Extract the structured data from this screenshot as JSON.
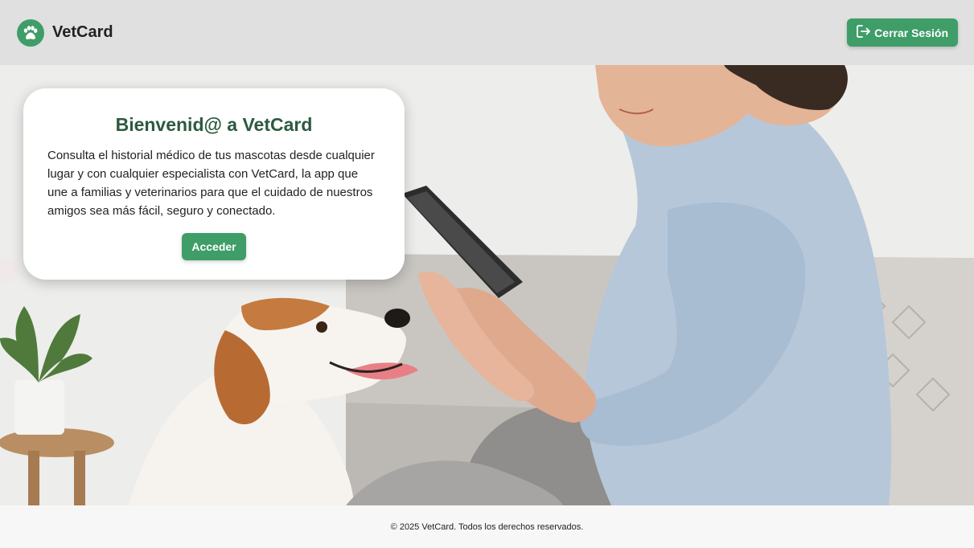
{
  "header": {
    "brand_name": "VetCard",
    "logo_icon": "paw-icon",
    "logout_icon": "logout-icon",
    "logout_label": "Cerrar Sesión"
  },
  "hero": {
    "image": "woman-with-tablet-and-dog-photo",
    "card": {
      "title": "Bienvenid@ a VetCard",
      "description": "Consulta el historial médico de tus mascotas desde cualquier lugar y con cualquier especialista con VetCard, la app que une a familias y veterinarios para que el cuidado de nuestros amigos sea más fácil, seguro y conectado.",
      "button_label": "Acceder"
    }
  },
  "footer": {
    "text": "© 2025 VetCard. Todos los derechos reservados."
  },
  "colors": {
    "accent": "#3f9d68",
    "title": "#2b5a3f",
    "header_bg": "#e0e0e0",
    "footer_bg": "#f7f7f7"
  }
}
